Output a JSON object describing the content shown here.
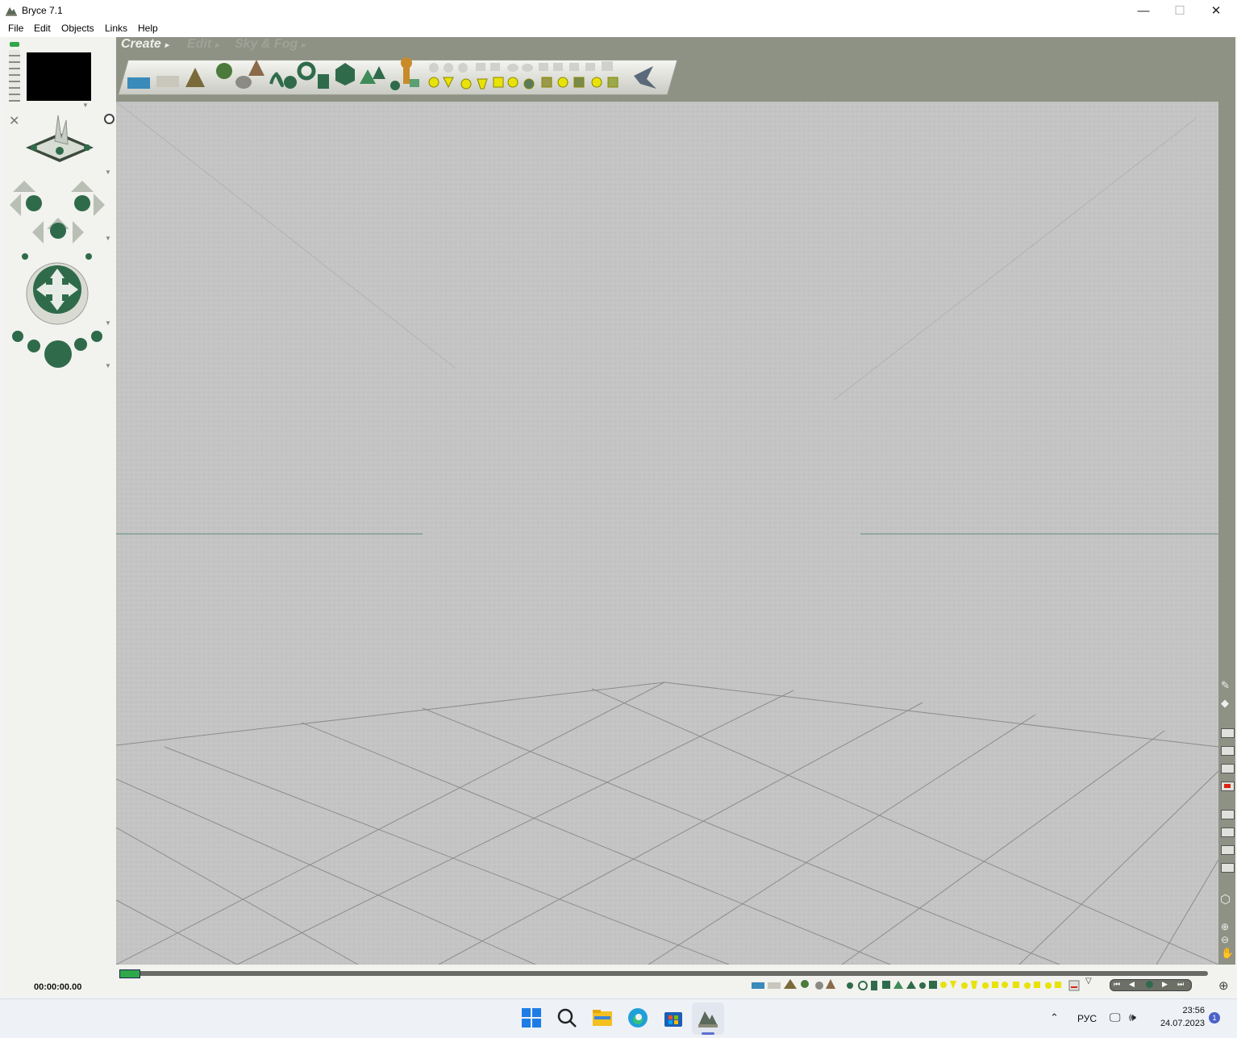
{
  "window": {
    "title": "Bryce 7.1",
    "minimize": "—",
    "maximize": "☐",
    "close": "✕"
  },
  "menu": [
    "File",
    "Edit",
    "Objects",
    "Links",
    "Help"
  ],
  "palette_tabs": [
    {
      "label": "Create",
      "active": true
    },
    {
      "label": "Edit",
      "active": false
    },
    {
      "label": "Sky & Fog",
      "active": false
    }
  ],
  "timeline": {
    "time": "00:00:00.00"
  },
  "tray": {
    "language": "РУС",
    "time": "23:56",
    "date": "24.07.2023",
    "notifications": "1"
  },
  "colors": {
    "workspace": "#8e9285",
    "viewport": "#c4c4c4",
    "accent_green": "#2f6b4a"
  }
}
